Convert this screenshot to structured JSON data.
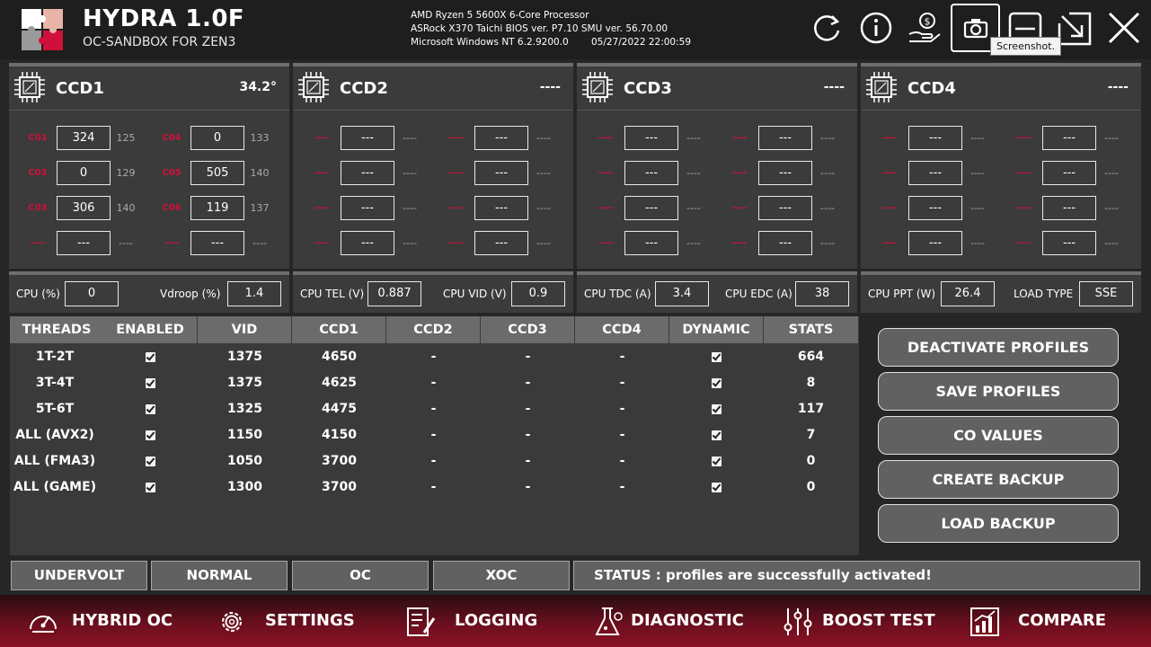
{
  "app": {
    "title": "HYDRA 1.0F",
    "subtitle": "OC-SANDBOX FOR ZEN3"
  },
  "sysinfo": {
    "cpu": "AMD Ryzen 5 5600X 6-Core Processor",
    "board": "ASRock X370 Taichi BIOS ver. P7.10 SMU ver. 56.70.00",
    "os": "Microsoft Windows NT 6.2.9200.0",
    "datetime": "05/27/2022 22:00:59"
  },
  "header_icons": [
    "refresh-icon",
    "info-icon",
    "donate-icon",
    "camera-icon",
    "minimize-icon",
    "resize-icon",
    "close-icon"
  ],
  "tooltip": "Screenshot.",
  "ccds": [
    {
      "name": "CCD1",
      "temp": "34.2°",
      "cores": [
        {
          "label": "C01",
          "value": "324",
          "max": "125"
        },
        {
          "label": "C04",
          "value": "0",
          "max": "133"
        },
        {
          "label": "C02",
          "value": "0",
          "max": "129"
        },
        {
          "label": "C05",
          "value": "505",
          "max": "140"
        },
        {
          "label": "C03",
          "value": "306",
          "max": "140"
        },
        {
          "label": "C06",
          "value": "119",
          "max": "137"
        },
        {
          "label": "----",
          "value": "---",
          "max": "----"
        },
        {
          "label": "----",
          "value": "---",
          "max": "----"
        }
      ]
    },
    {
      "name": "CCD2",
      "temp": "----",
      "cores": [
        {
          "label": "----",
          "value": "---",
          "max": "----"
        },
        {
          "label": "----",
          "value": "---",
          "max": "----"
        },
        {
          "label": "----",
          "value": "---",
          "max": "----"
        },
        {
          "label": "----",
          "value": "---",
          "max": "----"
        },
        {
          "label": "----",
          "value": "---",
          "max": "----"
        },
        {
          "label": "----",
          "value": "---",
          "max": "----"
        },
        {
          "label": "----",
          "value": "---",
          "max": "----"
        },
        {
          "label": "----",
          "value": "---",
          "max": "----"
        }
      ]
    },
    {
      "name": "CCD3",
      "temp": "----",
      "cores": [
        {
          "label": "----",
          "value": "---",
          "max": "----"
        },
        {
          "label": "----",
          "value": "---",
          "max": "----"
        },
        {
          "label": "----",
          "value": "---",
          "max": "----"
        },
        {
          "label": "----",
          "value": "---",
          "max": "----"
        },
        {
          "label": "----",
          "value": "---",
          "max": "----"
        },
        {
          "label": "----",
          "value": "---",
          "max": "----"
        },
        {
          "label": "----",
          "value": "---",
          "max": "----"
        },
        {
          "label": "----",
          "value": "---",
          "max": "----"
        }
      ]
    },
    {
      "name": "CCD4",
      "temp": "----",
      "cores": [
        {
          "label": "----",
          "value": "---",
          "max": "----"
        },
        {
          "label": "----",
          "value": "---",
          "max": "----"
        },
        {
          "label": "----",
          "value": "---",
          "max": "----"
        },
        {
          "label": "----",
          "value": "---",
          "max": "----"
        },
        {
          "label": "----",
          "value": "---",
          "max": "----"
        },
        {
          "label": "----",
          "value": "---",
          "max": "----"
        },
        {
          "label": "----",
          "value": "---",
          "max": "----"
        },
        {
          "label": "----",
          "value": "---",
          "max": "----"
        }
      ]
    }
  ],
  "metrics": [
    [
      {
        "label": "CPU (%)",
        "value": "0"
      },
      {
        "label": "Vdroop (%)",
        "value": "1.4"
      }
    ],
    [
      {
        "label": "CPU TEL (V)",
        "value": "0.887"
      },
      {
        "label": "CPU VID (V)",
        "value": "0.9"
      }
    ],
    [
      {
        "label": "CPU TDC (A)",
        "value": "3.4"
      },
      {
        "label": "CPU EDC (A)",
        "value": "38"
      }
    ],
    [
      {
        "label": "CPU PPT (W)",
        "value": "26.4"
      },
      {
        "label": "LOAD TYPE",
        "value": "SSE"
      }
    ]
  ],
  "table": {
    "headers": [
      "THREADS",
      "ENABLED",
      "VID",
      "CCD1",
      "CCD2",
      "CCD3",
      "CCD4",
      "DYNAMIC",
      "STATS"
    ],
    "rows": [
      {
        "threads": "1T-2T",
        "enabled": true,
        "vid": "1375",
        "ccd1": "4650",
        "ccd2": "-",
        "ccd3": "-",
        "ccd4": "-",
        "dynamic": true,
        "stats": "664"
      },
      {
        "threads": "3T-4T",
        "enabled": true,
        "vid": "1375",
        "ccd1": "4625",
        "ccd2": "-",
        "ccd3": "-",
        "ccd4": "-",
        "dynamic": true,
        "stats": "8"
      },
      {
        "threads": "5T-6T",
        "enabled": true,
        "vid": "1325",
        "ccd1": "4475",
        "ccd2": "-",
        "ccd3": "-",
        "ccd4": "-",
        "dynamic": true,
        "stats": "117"
      },
      {
        "threads": "ALL (AVX2)",
        "enabled": true,
        "vid": "1150",
        "ccd1": "4150",
        "ccd2": "-",
        "ccd3": "-",
        "ccd4": "-",
        "dynamic": true,
        "stats": "7"
      },
      {
        "threads": "ALL (FMA3)",
        "enabled": true,
        "vid": "1050",
        "ccd1": "3700",
        "ccd2": "-",
        "ccd3": "-",
        "ccd4": "-",
        "dynamic": true,
        "stats": "0"
      },
      {
        "threads": "ALL (GAME)",
        "enabled": true,
        "vid": "1300",
        "ccd1": "3700",
        "ccd2": "-",
        "ccd3": "-",
        "ccd4": "-",
        "dynamic": true,
        "stats": "0"
      }
    ]
  },
  "actions": [
    "DEACTIVATE PROFILES",
    "SAVE PROFILES",
    "CO VALUES",
    "CREATE BACKUP",
    "LOAD BACKUP"
  ],
  "modes": [
    "UNDERVOLT",
    "NORMAL",
    "OC",
    "XOC"
  ],
  "status": "STATUS : profiles are successfully activated!",
  "nav": [
    {
      "label": "HYBRID OC",
      "icon": "gauge-icon"
    },
    {
      "label": "SETTINGS",
      "icon": "gear-icon"
    },
    {
      "label": "LOGGING",
      "icon": "log-icon"
    },
    {
      "label": "DIAGNOSTIC",
      "icon": "flask-icon"
    },
    {
      "label": "BOOST TEST",
      "icon": "sliders-icon"
    },
    {
      "label": "COMPARE",
      "icon": "bar-chart-icon"
    }
  ],
  "colors": {
    "accent": "#d0103a",
    "panel": "#3b3b3b",
    "header": "#6b6b6b"
  }
}
